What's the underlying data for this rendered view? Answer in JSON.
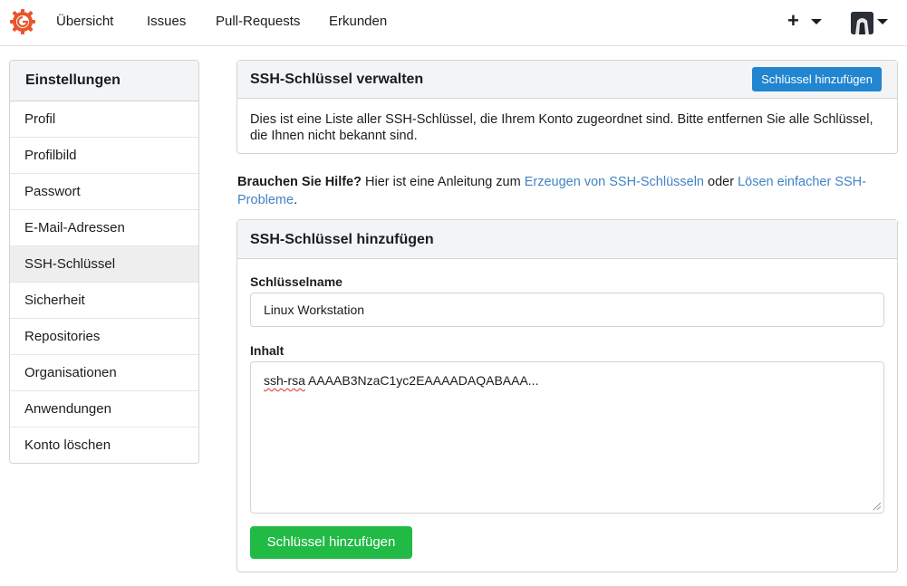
{
  "navbar": {
    "logo_icon": "gitea-logo-icon",
    "items": [
      {
        "label": "Übersicht"
      },
      {
        "label": "Issues"
      },
      {
        "label": "Pull-Requests"
      },
      {
        "label": "Erkunden"
      }
    ],
    "create_icon": "plus-icon",
    "user_icon": "avatar-icon",
    "accent": "#e8562a"
  },
  "sidebar": {
    "title": "Einstellungen",
    "items": [
      {
        "label": "Profil"
      },
      {
        "label": "Profilbild"
      },
      {
        "label": "Passwort"
      },
      {
        "label": "E-Mail-Adressen"
      },
      {
        "label": "SSH-Schlüssel",
        "active": true
      },
      {
        "label": "Sicherheit"
      },
      {
        "label": "Repositories"
      },
      {
        "label": "Organisationen"
      },
      {
        "label": "Anwendungen"
      },
      {
        "label": "Konto löschen"
      }
    ]
  },
  "manage": {
    "title": "SSH-Schlüssel verwalten",
    "add_button": "Schlüssel hinzufügen",
    "description": "Dies ist eine Liste aller SSH-Schlüssel, die Ihrem Konto zugeordnet sind. Bitte entfernen Sie alle Schlüssel, die Ihnen nicht bekannt sind."
  },
  "help": {
    "bold": "Brauchen Sie Hilfe?",
    "text1": " Hier ist eine Anleitung zum ",
    "link1": "Erzeugen von SSH-Schlüsseln",
    "text2": " oder ",
    "link2": "Lösen einfacher SSH-Probleme",
    "text3": "."
  },
  "add_form": {
    "title": "SSH-Schlüssel hinzufügen",
    "name_label": "Schlüsselname",
    "name_value": "Linux Workstation",
    "content_label": "Inhalt",
    "content_prefix": "ssh-rsa",
    "content_rest": " AAAAB3NzaC1yc2EAAAADAQABAAA...",
    "submit_button": "Schlüssel hinzufügen"
  },
  "colors": {
    "primary": "#2185d0",
    "success": "#21ba45",
    "link": "#4183c4"
  }
}
